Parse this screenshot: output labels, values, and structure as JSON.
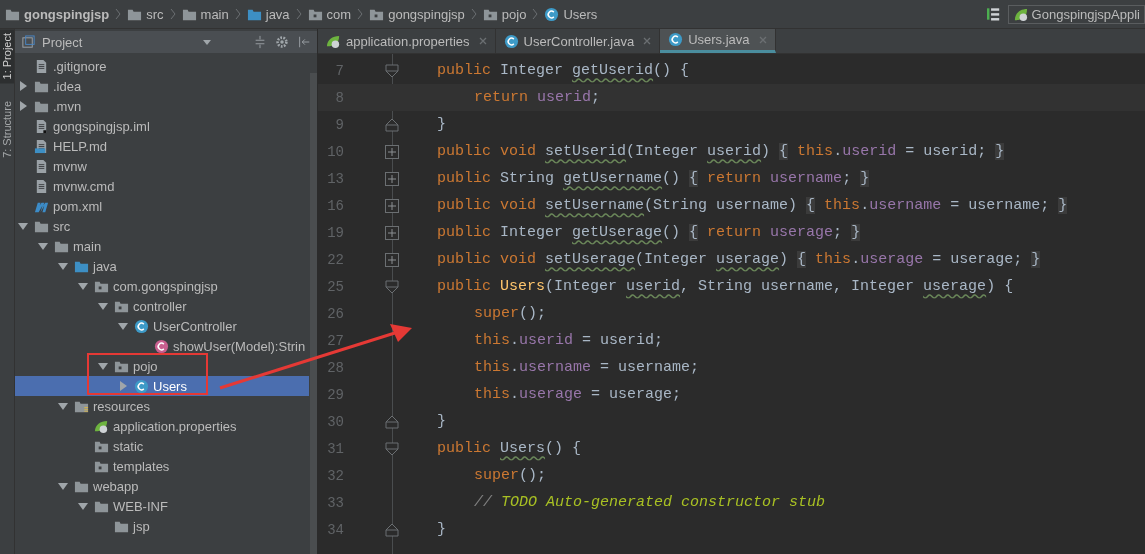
{
  "breadcrumbs": [
    {
      "label": "gongspingjsp",
      "kind": "project"
    },
    {
      "label": "src",
      "kind": "folder"
    },
    {
      "label": "main",
      "kind": "folder"
    },
    {
      "label": "java",
      "kind": "src-folder"
    },
    {
      "label": "com",
      "kind": "package"
    },
    {
      "label": "gongspingjsp",
      "kind": "package"
    },
    {
      "label": "pojo",
      "kind": "package"
    },
    {
      "label": "Users",
      "kind": "class"
    }
  ],
  "run_config": {
    "label": "GongspingjspAppli"
  },
  "side_tabs": [
    {
      "label": "1: Project",
      "selected": true
    },
    {
      "label": "7: Structure",
      "selected": false
    }
  ],
  "project_panel": {
    "title": "Project"
  },
  "tree": {
    "items": [
      {
        "label": ".gitignore",
        "kind": "file",
        "selected": false
      },
      {
        "label": ".idea",
        "kind": "folder",
        "expanded": false,
        "selected": false
      },
      {
        "label": ".mvn",
        "kind": "folder",
        "expanded": false,
        "selected": false
      },
      {
        "label": "gongspingjsp.iml",
        "kind": "iml",
        "selected": false
      },
      {
        "label": "HELP.md",
        "kind": "md",
        "selected": false
      },
      {
        "label": "mvnw",
        "kind": "file",
        "selected": false
      },
      {
        "label": "mvnw.cmd",
        "kind": "file",
        "selected": false
      },
      {
        "label": "pom.xml",
        "kind": "maven",
        "selected": false
      },
      {
        "label": "src",
        "kind": "folder",
        "expanded": true,
        "selected": false,
        "children": [
          {
            "label": "main",
            "kind": "folder",
            "expanded": true,
            "selected": false,
            "children": [
              {
                "label": "java",
                "kind": "src-folder",
                "expanded": true,
                "selected": false,
                "children": [
                  {
                    "label": "com.gongspingjsp",
                    "kind": "package",
                    "expanded": true,
                    "selected": false,
                    "children": [
                      {
                        "label": "controller",
                        "kind": "package",
                        "expanded": true,
                        "selected": false,
                        "children": [
                          {
                            "label": "UserController",
                            "kind": "class",
                            "expanded": true,
                            "selected": false,
                            "children": [
                              {
                                "label": "showUser(Model):Strin",
                                "kind": "method",
                                "selected": false
                              }
                            ]
                          }
                        ]
                      },
                      {
                        "label": "pojo",
                        "kind": "package",
                        "expanded": true,
                        "selected": false,
                        "children": [
                          {
                            "label": "Users",
                            "kind": "class",
                            "expanded": false,
                            "selected": true
                          }
                        ]
                      }
                    ]
                  }
                ]
              },
              {
                "label": "resources",
                "kind": "resources",
                "expanded": true,
                "selected": false,
                "children": [
                  {
                    "label": "application.properties",
                    "kind": "spring",
                    "selected": false
                  },
                  {
                    "label": "static",
                    "kind": "package",
                    "selected": false
                  },
                  {
                    "label": "templates",
                    "kind": "package",
                    "selected": false
                  }
                ]
              },
              {
                "label": "webapp",
                "kind": "folder",
                "expanded": true,
                "selected": false,
                "children": [
                  {
                    "label": "WEB-INF",
                    "kind": "folder",
                    "expanded": true,
                    "selected": false,
                    "children": [
                      {
                        "label": "jsp",
                        "kind": "folder",
                        "selected": false
                      }
                    ]
                  }
                ]
              }
            ]
          }
        ]
      }
    ]
  },
  "editor_tabs": [
    {
      "label": "application.properties",
      "kind": "spring",
      "selected": false
    },
    {
      "label": "UserController.java",
      "kind": "class",
      "selected": false
    },
    {
      "label": "Users.java",
      "kind": "class",
      "selected": true
    }
  ],
  "code_lines": [
    {
      "number": "7",
      "kind": "block-start",
      "current": false,
      "tokens": [
        {
          "text": "public ",
          "kind": "kw"
        },
        {
          "text": "Integer ",
          "kind": "plain"
        },
        {
          "text": "getUserid",
          "kind": "warn"
        },
        {
          "text": "() {",
          "kind": "plain"
        }
      ]
    },
    {
      "number": "8",
      "kind": "statement",
      "current": true,
      "tokens": [
        {
          "text": "return ",
          "kind": "kw"
        },
        {
          "text": "userid",
          "kind": "field"
        },
        {
          "text": ";",
          "kind": "plain"
        }
      ]
    },
    {
      "number": "9",
      "kind": "block-end",
      "current": false,
      "tokens": [
        {
          "text": "}",
          "kind": "plain"
        }
      ]
    },
    {
      "number": "10",
      "kind": "folded",
      "current": false,
      "tokens": [
        {
          "text": "public void ",
          "kind": "kw"
        },
        {
          "text": "setUserid",
          "kind": "warn"
        },
        {
          "text": "(Integer ",
          "kind": "plain"
        },
        {
          "text": "userid",
          "kind": "warn"
        },
        {
          "text": ") ",
          "kind": "plain"
        },
        {
          "text": "{",
          "kind": "brace"
        },
        {
          "text": " this",
          "kind": "kw"
        },
        {
          "text": ".",
          "kind": "plain"
        },
        {
          "text": "userid",
          "kind": "field"
        },
        {
          "text": " = userid; ",
          "kind": "plain"
        },
        {
          "text": "}",
          "kind": "brace"
        }
      ]
    },
    {
      "number": "13",
      "kind": "folded",
      "current": false,
      "tokens": [
        {
          "text": "public ",
          "kind": "kw"
        },
        {
          "text": "String ",
          "kind": "plain"
        },
        {
          "text": "getUsername",
          "kind": "warn"
        },
        {
          "text": "() ",
          "kind": "plain"
        },
        {
          "text": "{",
          "kind": "brace"
        },
        {
          "text": " return ",
          "kind": "kw"
        },
        {
          "text": "username",
          "kind": "field"
        },
        {
          "text": "; ",
          "kind": "plain"
        },
        {
          "text": "}",
          "kind": "brace"
        }
      ]
    },
    {
      "number": "16",
      "kind": "folded",
      "current": false,
      "tokens": [
        {
          "text": "public void ",
          "kind": "kw"
        },
        {
          "text": "setUsername",
          "kind": "warn"
        },
        {
          "text": "(String username) ",
          "kind": "plain"
        },
        {
          "text": "{",
          "kind": "brace"
        },
        {
          "text": " this",
          "kind": "kw"
        },
        {
          "text": ".",
          "kind": "plain"
        },
        {
          "text": "username",
          "kind": "field"
        },
        {
          "text": " = username; ",
          "kind": "plain"
        },
        {
          "text": "}",
          "kind": "brace"
        }
      ]
    },
    {
      "number": "19",
      "kind": "folded",
      "current": false,
      "tokens": [
        {
          "text": "public ",
          "kind": "kw"
        },
        {
          "text": "Integer ",
          "kind": "plain"
        },
        {
          "text": "getUserage",
          "kind": "warn"
        },
        {
          "text": "() ",
          "kind": "plain"
        },
        {
          "text": "{",
          "kind": "brace"
        },
        {
          "text": " return ",
          "kind": "kw"
        },
        {
          "text": "userage",
          "kind": "field"
        },
        {
          "text": "; ",
          "kind": "plain"
        },
        {
          "text": "}",
          "kind": "brace"
        }
      ]
    },
    {
      "number": "22",
      "kind": "folded",
      "current": false,
      "tokens": [
        {
          "text": "public void ",
          "kind": "kw"
        },
        {
          "text": "setUserage",
          "kind": "warn"
        },
        {
          "text": "(Integer ",
          "kind": "plain"
        },
        {
          "text": "userage",
          "kind": "warn"
        },
        {
          "text": ") ",
          "kind": "plain"
        },
        {
          "text": "{",
          "kind": "brace"
        },
        {
          "text": " this",
          "kind": "kw"
        },
        {
          "text": ".",
          "kind": "plain"
        },
        {
          "text": "userage",
          "kind": "field"
        },
        {
          "text": " = userage; ",
          "kind": "plain"
        },
        {
          "text": "}",
          "kind": "brace"
        }
      ]
    },
    {
      "number": "25",
      "kind": "block-start",
      "current": false,
      "tokens": [
        {
          "text": "public ",
          "kind": "kw"
        },
        {
          "text": "Users",
          "kind": "ctor"
        },
        {
          "text": "(Integer ",
          "kind": "plain"
        },
        {
          "text": "userid",
          "kind": "warn"
        },
        {
          "text": ", String username, Integer ",
          "kind": "plain"
        },
        {
          "text": "userage",
          "kind": "warn"
        },
        {
          "text": ") {",
          "kind": "plain"
        }
      ]
    },
    {
      "number": "26",
      "kind": "statement",
      "current": false,
      "tokens": [
        {
          "text": "super",
          "kind": "kw"
        },
        {
          "text": "();",
          "kind": "plain"
        }
      ]
    },
    {
      "number": "27",
      "kind": "statement",
      "current": false,
      "tokens": [
        {
          "text": "this",
          "kind": "kw"
        },
        {
          "text": ".",
          "kind": "plain"
        },
        {
          "text": "userid",
          "kind": "field"
        },
        {
          "text": " = userid;",
          "kind": "plain"
        }
      ]
    },
    {
      "number": "28",
      "kind": "statement",
      "current": false,
      "tokens": [
        {
          "text": "this",
          "kind": "kw"
        },
        {
          "text": ".",
          "kind": "plain"
        },
        {
          "text": "username",
          "kind": "field"
        },
        {
          "text": " = username;",
          "kind": "plain"
        }
      ]
    },
    {
      "number": "29",
      "kind": "statement",
      "current": false,
      "tokens": [
        {
          "text": "this",
          "kind": "kw"
        },
        {
          "text": ".",
          "kind": "plain"
        },
        {
          "text": "userage",
          "kind": "field"
        },
        {
          "text": " = userage;",
          "kind": "plain"
        }
      ]
    },
    {
      "number": "30",
      "kind": "block-end",
      "current": false,
      "tokens": [
        {
          "text": "}",
          "kind": "plain"
        }
      ]
    },
    {
      "number": "31",
      "kind": "block-start",
      "current": false,
      "tokens": [
        {
          "text": "public ",
          "kind": "kw"
        },
        {
          "text": "Users",
          "kind": "warn"
        },
        {
          "text": "() {",
          "kind": "plain"
        }
      ]
    },
    {
      "number": "32",
      "kind": "statement",
      "current": false,
      "tokens": [
        {
          "text": "super",
          "kind": "kw"
        },
        {
          "text": "();",
          "kind": "plain"
        }
      ]
    },
    {
      "number": "33",
      "kind": "statement",
      "current": false,
      "tokens": [
        {
          "text": "// ",
          "kind": "comment-mark"
        },
        {
          "text": "TODO Auto-generated constructor stub",
          "kind": "todo"
        }
      ]
    },
    {
      "number": "34",
      "kind": "block-end",
      "current": false,
      "tokens": [
        {
          "text": "}",
          "kind": "plain"
        }
      ]
    }
  ]
}
